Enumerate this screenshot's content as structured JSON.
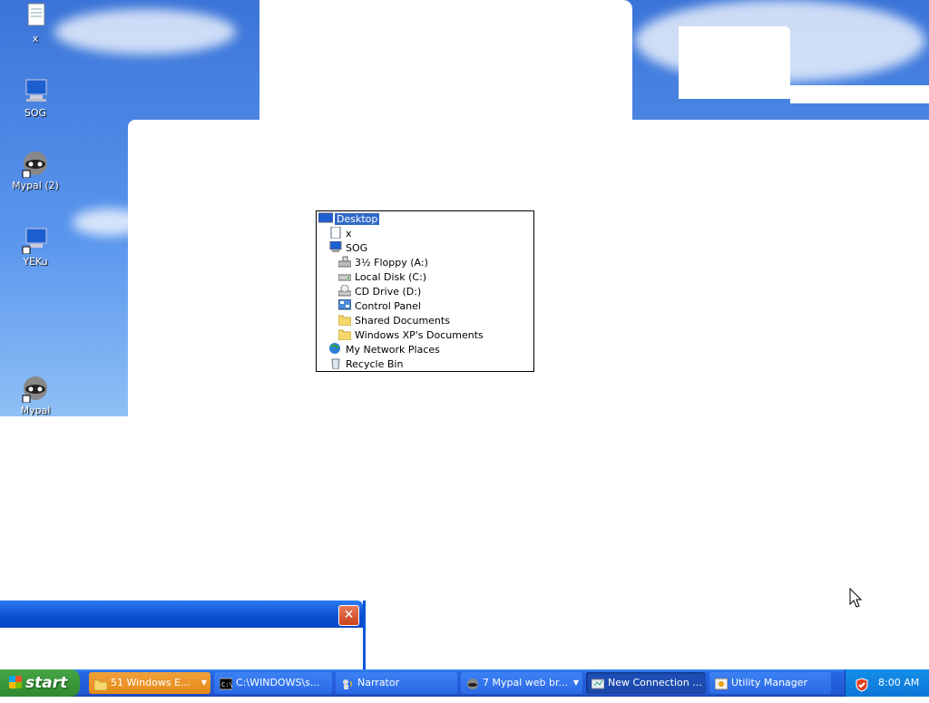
{
  "desktop": {
    "icons": [
      {
        "label": "x",
        "icon": "document-icon"
      },
      {
        "label": "SOG",
        "icon": "my-computer-icon"
      },
      {
        "label": "Mypal (2)",
        "icon": "mypal-raccoon-icon"
      },
      {
        "label": "YEKu",
        "icon": "my-computer-shortcut-icon"
      },
      {
        "label": "Mypal",
        "icon": "mypal-raccoon-icon"
      }
    ]
  },
  "tree": {
    "items": [
      {
        "label": "Desktop",
        "icon": "desktop-icon",
        "selected": true
      },
      {
        "label": "x",
        "icon": "document-icon"
      },
      {
        "label": "SOG",
        "icon": "my-computer-icon"
      },
      {
        "label": "3½ Floppy (A:)",
        "icon": "floppy-drive-icon"
      },
      {
        "label": "Local Disk (C:)",
        "icon": "hard-disk-icon"
      },
      {
        "label": "CD Drive (D:)",
        "icon": "cd-drive-icon"
      },
      {
        "label": "Control Panel",
        "icon": "control-panel-icon"
      },
      {
        "label": "Shared Documents",
        "icon": "folder-icon"
      },
      {
        "label": "Windows XP's Documents",
        "icon": "folder-icon"
      },
      {
        "label": "My Network Places",
        "icon": "network-places-icon"
      },
      {
        "label": "Recycle Bin",
        "icon": "recycle-bin-icon"
      }
    ]
  },
  "window": {
    "close_label": "✕"
  },
  "taskbar": {
    "start_label": "start",
    "buttons": [
      {
        "label": "51 Windows E...",
        "icon": "folder-icon"
      },
      {
        "label": "C:\\WINDOWS\\s...",
        "icon": "command-prompt-icon"
      },
      {
        "label": "Narrator",
        "icon": "narrator-icon"
      },
      {
        "label": "7 Mypal web br...",
        "icon": "mypal-raccoon-icon"
      },
      {
        "label": "New Connection ...",
        "icon": "connection-wizard-icon"
      },
      {
        "label": "Utility Manager",
        "icon": "utility-manager-icon"
      }
    ],
    "clock": "8:00 AM"
  },
  "colors": {
    "taskbar_blue": "#245edb",
    "start_green": "#3c9b3c",
    "selection": "#316ac5",
    "tray_blue": "#0f82e0"
  }
}
